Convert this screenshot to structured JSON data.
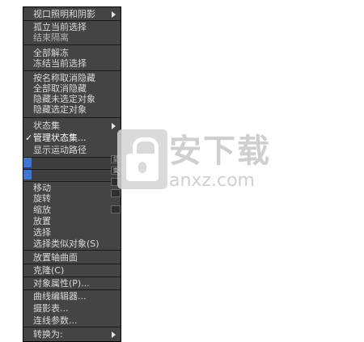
{
  "menu": {
    "items": [
      {
        "label": "视口照明和阴影",
        "submenu": true
      },
      {
        "label": "孤立当前选择"
      },
      {
        "label": "结束隔离"
      },
      {
        "label": "全部解冻"
      },
      {
        "label": "冻结当前选择"
      },
      {
        "label": "按名称取消隐藏"
      },
      {
        "label": "全部取消隐藏"
      },
      {
        "label": "隐藏未选定对象"
      },
      {
        "label": "隐藏选定对象"
      },
      {
        "label": "状态集",
        "submenu": true
      },
      {
        "label": "管理状态集...",
        "checked": true,
        "check_mark": "✓"
      },
      {
        "label": "显示运动路径"
      },
      {
        "label": "移动"
      },
      {
        "label": "旋转"
      },
      {
        "label": "缩放"
      },
      {
        "label": "放置"
      },
      {
        "label": "选择"
      },
      {
        "label": "选择类似对象(S)"
      },
      {
        "label": "放置轴曲面"
      },
      {
        "label": "克隆(C)"
      },
      {
        "label": "对象属性(P)..."
      },
      {
        "label": "曲线编辑器..."
      },
      {
        "label": "摄影表..."
      },
      {
        "label": "连线参数..."
      },
      {
        "label": "转换为:",
        "submenu": true
      }
    ]
  },
  "side_icons": [
    "显示",
    "变换",
    "",
    ""
  ],
  "watermark": {
    "title": "安下载",
    "subtitle": "anxz.com"
  },
  "colors": {
    "menu_bg": "#444444",
    "text": "#dadada",
    "accent_swatch": "#3b78d6"
  }
}
